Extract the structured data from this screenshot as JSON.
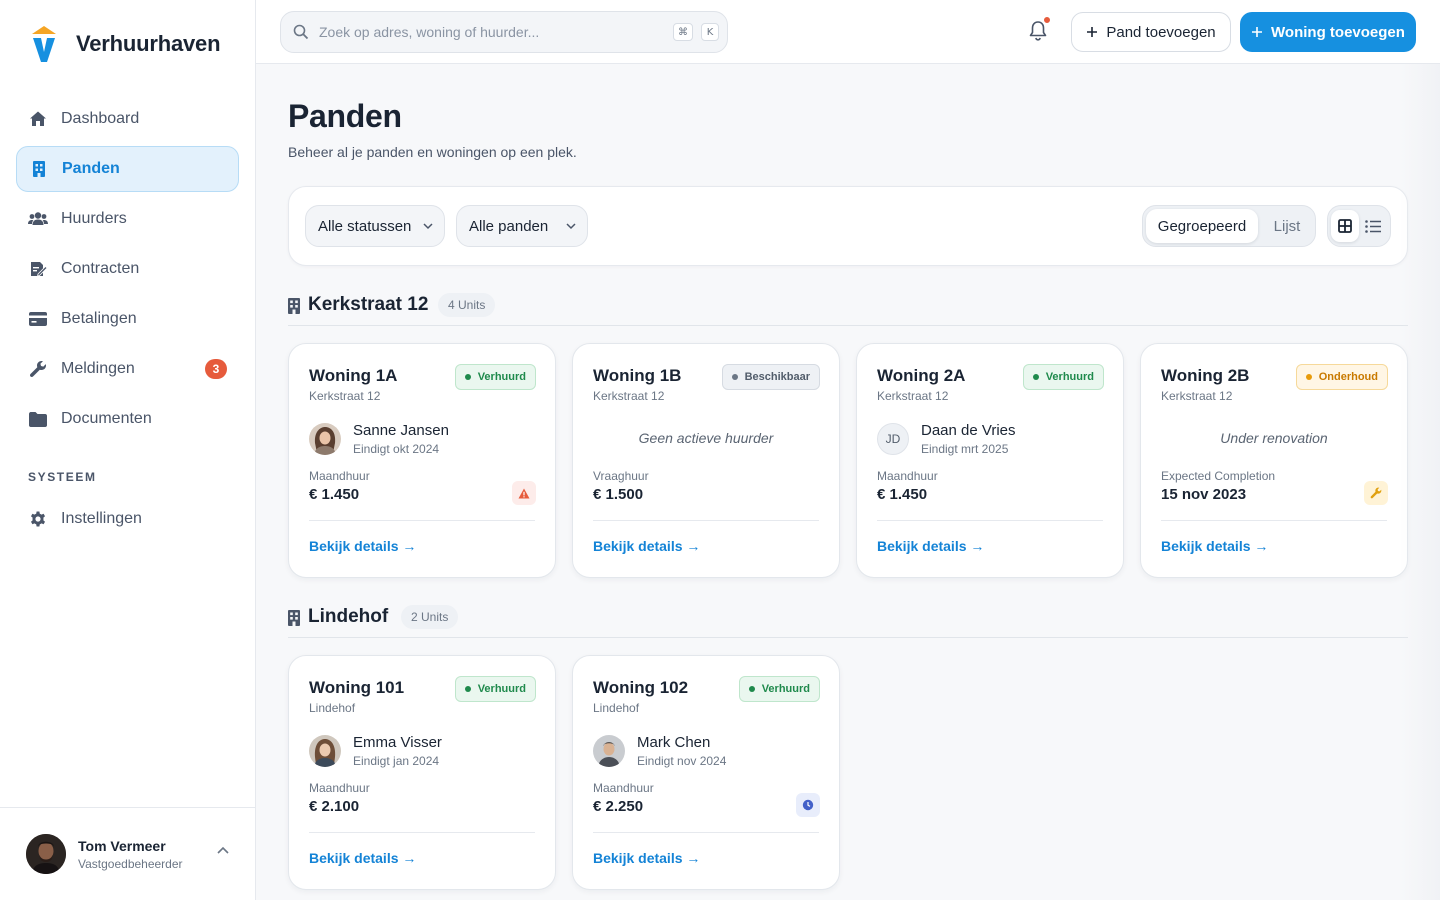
{
  "app": {
    "name": "Verhuurhaven"
  },
  "sidebar": {
    "items": [
      {
        "label": "Dashboard",
        "icon": "home-icon"
      },
      {
        "label": "Panden",
        "icon": "building-icon",
        "active": true
      },
      {
        "label": "Huurders",
        "icon": "users-icon"
      },
      {
        "label": "Contracten",
        "icon": "contract-icon"
      },
      {
        "label": "Betalingen",
        "icon": "credit-card-icon"
      },
      {
        "label": "Meldingen",
        "icon": "wrench-icon",
        "badge": "3"
      },
      {
        "label": "Documenten",
        "icon": "folder-icon"
      }
    ],
    "section_label": "SYSTEEM",
    "system_items": [
      {
        "label": "Instellingen",
        "icon": "gear-icon"
      }
    ],
    "user": {
      "name": "Tom Vermeer",
      "role": "Vastgoedbeheerder"
    }
  },
  "topbar": {
    "search_placeholder": "Zoek op adres, woning of huurder...",
    "shortcut_keys": [
      "⌘",
      "K"
    ],
    "add_property_label": "Pand toevoegen",
    "add_unit_label": "Woning toevoegen"
  },
  "page": {
    "title": "Panden",
    "subtitle": "Beheer al je panden en woningen op een plek."
  },
  "filters": {
    "status_select": "Alle statussen",
    "property_select": "Alle panden",
    "grouping_active": "Gegroepeerd",
    "grouping_other": "Lijst"
  },
  "groups": [
    {
      "name": "Kerkstraat 12",
      "count_label": "4 Units",
      "cards": [
        {
          "title": "Woning 1A",
          "address": "Kerkstraat 12",
          "status": "Verhuurd",
          "tenant_name": "Sanne Jansen",
          "tenant_end": "Eindigt okt 2024",
          "value_label": "Maandhuur",
          "value": "€ 1.450",
          "link": "Bekijk details →"
        },
        {
          "title": "Woning 1B",
          "address": "Kerkstraat 12",
          "status": "Beschikbaar",
          "empty_text": "Geen actieve huurder",
          "value_label": "Vraaghuur",
          "value": "€ 1.500",
          "link": "Bekijk details →"
        },
        {
          "title": "Woning 2A",
          "address": "Kerkstraat 12",
          "status": "Verhuurd",
          "tenant_initials": "JD",
          "tenant_name": "Daan de Vries",
          "tenant_end": "Eindigt mrt 2025",
          "value_label": "Maandhuur",
          "value": "€ 1.450",
          "link": "Bekijk details →"
        },
        {
          "title": "Woning 2B",
          "address": "Kerkstraat 12",
          "status": "Onderhoud",
          "empty_text": "Under renovation",
          "value_label": "Expected Completion",
          "value": "15 nov 2023",
          "link": "Bekijk details →"
        }
      ]
    },
    {
      "name": "Lindehof",
      "count_label": "2 Units",
      "cards": [
        {
          "title": "Woning 101",
          "address": "Lindehof",
          "status": "Verhuurd",
          "tenant_name": "Emma Visser",
          "tenant_end": "Eindigt jan 2024",
          "value_label": "Maandhuur",
          "value": "€ 2.100",
          "link": "Bekijk details →"
        },
        {
          "title": "Woning 102",
          "address": "Lindehof",
          "status": "Verhuurd",
          "tenant_name": "Mark Chen",
          "tenant_end": "Eindigt nov 2024",
          "value_label": "Maandhuur",
          "value": "€ 2.250",
          "link": "Bekijk details →"
        }
      ]
    }
  ],
  "colors": {
    "accent": "#1690e0",
    "rented": "#1f8a4c",
    "available": "#525d6b",
    "maintenance": "#c97a00",
    "alert": "#e65b3c"
  }
}
